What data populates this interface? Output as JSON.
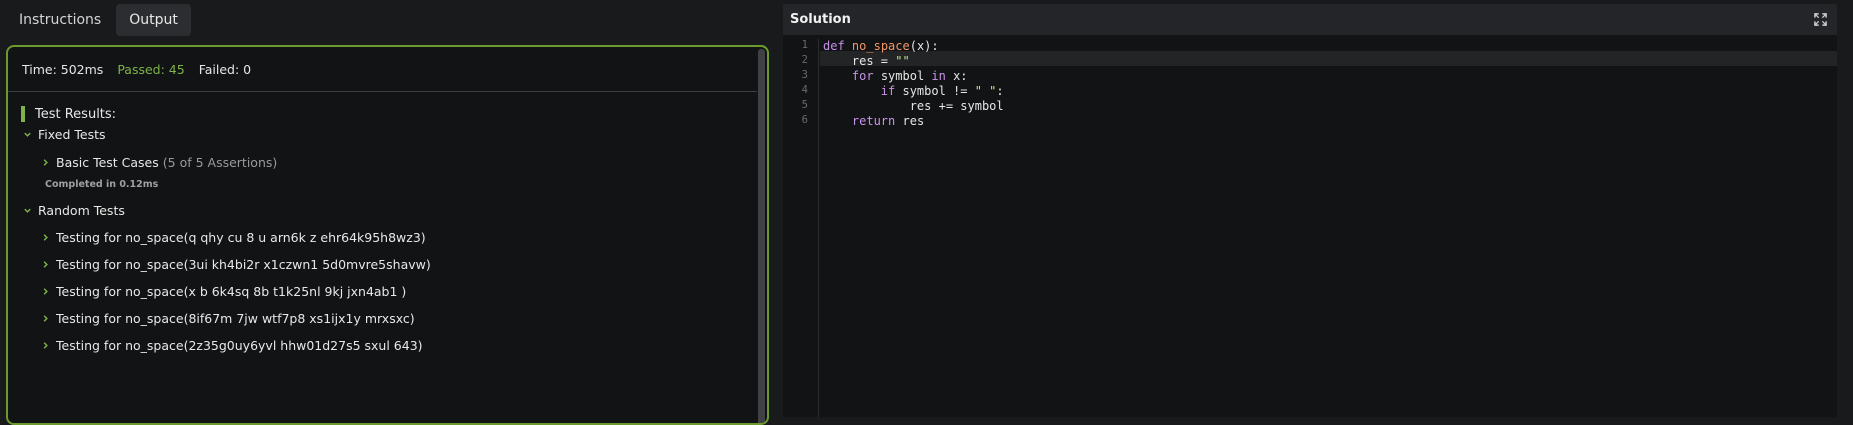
{
  "tabs": [
    {
      "label": "Instructions",
      "active": false
    },
    {
      "label": "Output",
      "active": true
    }
  ],
  "stats": {
    "time": "Time: 502ms",
    "passed": "Passed: 45",
    "failed": "Failed: 0"
  },
  "results": {
    "title": "Test Results:",
    "fixed_group": "Fixed Tests",
    "basic_case": "Basic Test Cases",
    "basic_assertions": "(5 of 5 Assertions)",
    "completed": "Completed in 0.12ms",
    "random_group": "Random Tests",
    "random_items": [
      "Testing for no_space(q qhy cu 8 u arn6k z ehr64k95h8wz3)",
      "Testing for no_space(3ui  kh4bi2r x1czwn1 5d0mvre5shavw)",
      "Testing for no_space(x b 6k4sq 8b t1k25nl 9kj  jxn4ab1 )",
      "Testing for no_space(8if67m 7jw wtf7p8 xs1ijx1y  mrxsxc)",
      "Testing for no_space(2z35g0uy6yvl hhw01d27s5 sxul   643)"
    ]
  },
  "solution": {
    "title": "Solution",
    "line_numbers": [
      "1",
      "2",
      "3",
      "4",
      "5",
      "6"
    ],
    "code": {
      "l1_def": "def",
      "l1_name": "no_space",
      "l1_rest": "(x):",
      "l2_text": "    res = ",
      "l2_str": "\"\"",
      "l3_indent": "    ",
      "l3_for": "for",
      "l3_mid": " symbol ",
      "l3_in": "in",
      "l3_rest": " x:",
      "l4_indent": "        ",
      "l4_if": "if",
      "l4_mid": " symbol != ",
      "l4_str": "\" \"",
      "l4_rest": ":",
      "l5_text": "            res += symbol",
      "l6_indent": "    ",
      "l6_return": "return",
      "l6_rest": " res"
    }
  },
  "colors": {
    "accent": "#7fb24a",
    "panel_border": "#6c9a2d",
    "keyword": "#c792ea",
    "function": "#f29668",
    "string": "#c3e88d"
  },
  "icons": {
    "chevron_right": "chevron-right-icon",
    "chevron_down": "chevron-down-icon",
    "expand": "expand-icon"
  }
}
